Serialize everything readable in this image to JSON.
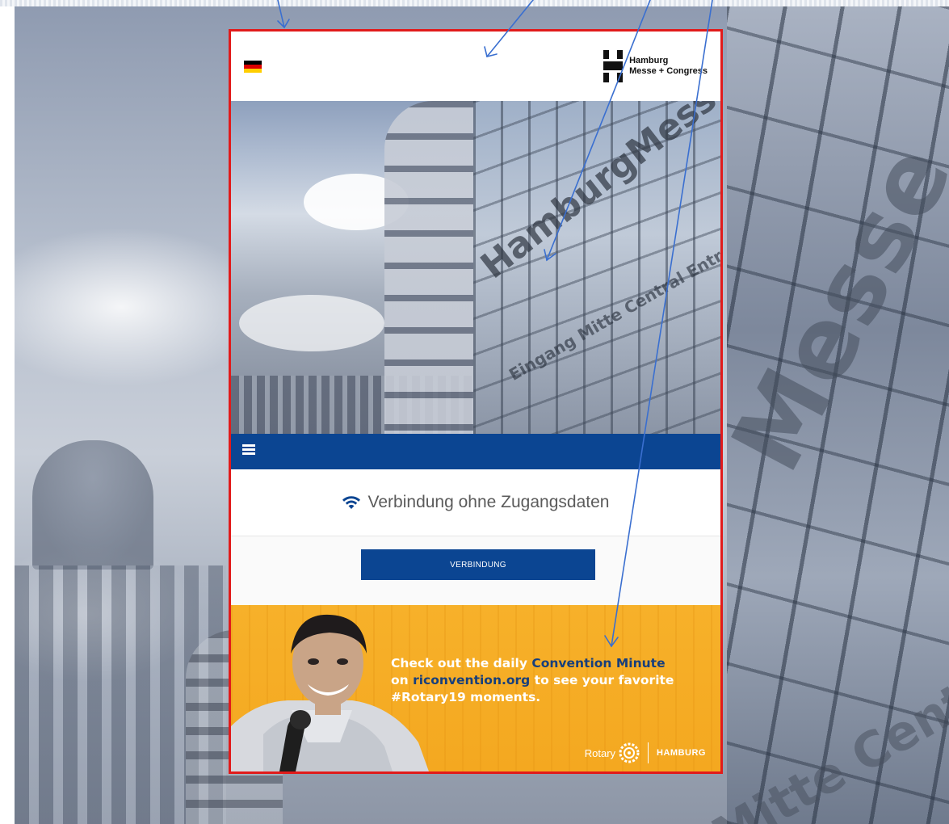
{
  "header": {
    "logo_line1": "Hamburg",
    "logo_line2": "Messe + Congress",
    "flag_colors": [
      "#000000",
      "#dd0000",
      "#ffce00"
    ]
  },
  "hero": {
    "sign_text": "HamburgMesse",
    "sign_subtext": "Eingang Mitte Central Entrance"
  },
  "background": {
    "facade_text": "Messe",
    "facade_subtext": "Mitte Central Entr"
  },
  "connection": {
    "wifi_label": "Verbindung ohne Zugangsdaten",
    "button_label": "VERBINDUNG"
  },
  "ad": {
    "line1_a": "Check out the daily ",
    "line1_b": "Convention Minute",
    "line2_a": "on ",
    "line2_b": "riconvention.org",
    "line2_c": " to see your favorite",
    "line3_a": "#Rotary19",
    "line3_b": " moments.",
    "rotary_label": "Rotary",
    "hamburg_label": "HAMBURG"
  },
  "colors": {
    "frame_border": "#e11b1b",
    "nav_blue": "#0b4592",
    "ad_orange": "#f7b12a",
    "ad_highlight": "#173f7c",
    "annotation_arrow": "#3a6fd0"
  }
}
